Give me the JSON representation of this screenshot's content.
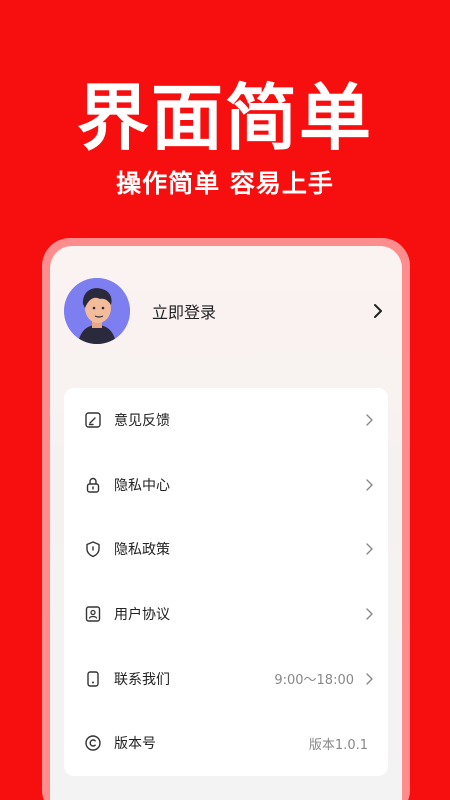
{
  "hero": {
    "title": "界面简单",
    "subtitle": "操作简单 容易上手"
  },
  "profile": {
    "login_label": "立即登录",
    "avatar_icon": "avatar-illustration"
  },
  "menu": {
    "items": [
      {
        "label": "意见反馈",
        "icon": "feedback-icon",
        "value": ""
      },
      {
        "label": "隐私中心",
        "icon": "lock-icon",
        "value": ""
      },
      {
        "label": "隐私政策",
        "icon": "shield-icon",
        "value": ""
      },
      {
        "label": "用户协议",
        "icon": "user-agreement-icon",
        "value": ""
      },
      {
        "label": "联系我们",
        "icon": "phone-icon",
        "value": "9:00～18:00"
      },
      {
        "label": "版本号",
        "icon": "copyright-icon",
        "value": "版本1.0.1"
      }
    ]
  },
  "colors": {
    "background": "#f70f0f",
    "phone_frame": "#ff8d8d",
    "avatar_bg": "#7d7ef0"
  }
}
